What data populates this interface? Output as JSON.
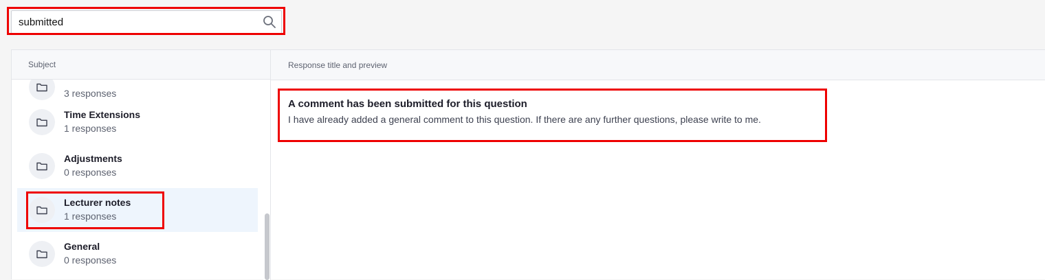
{
  "search": {
    "value": "submitted",
    "icon": "search-icon"
  },
  "subjects": {
    "header": "Subject",
    "items": [
      {
        "title": "",
        "count": "3 responses"
      },
      {
        "title": "Time Extensions",
        "count": "1 responses"
      },
      {
        "title": "Adjustments",
        "count": "0 responses"
      },
      {
        "title": "Lecturer notes",
        "count": "1 responses"
      },
      {
        "title": "General",
        "count": "0 responses"
      }
    ],
    "icon": "folder-icon"
  },
  "responses": {
    "header": "Response title and preview",
    "items": [
      {
        "title": "A comment has been submitted for this question",
        "preview": "I have already added a general comment to this question. If there are any further questions, please write to me."
      }
    ]
  },
  "colors": {
    "highlight": "#ee0000",
    "selected_bg": "#eef5fd"
  }
}
